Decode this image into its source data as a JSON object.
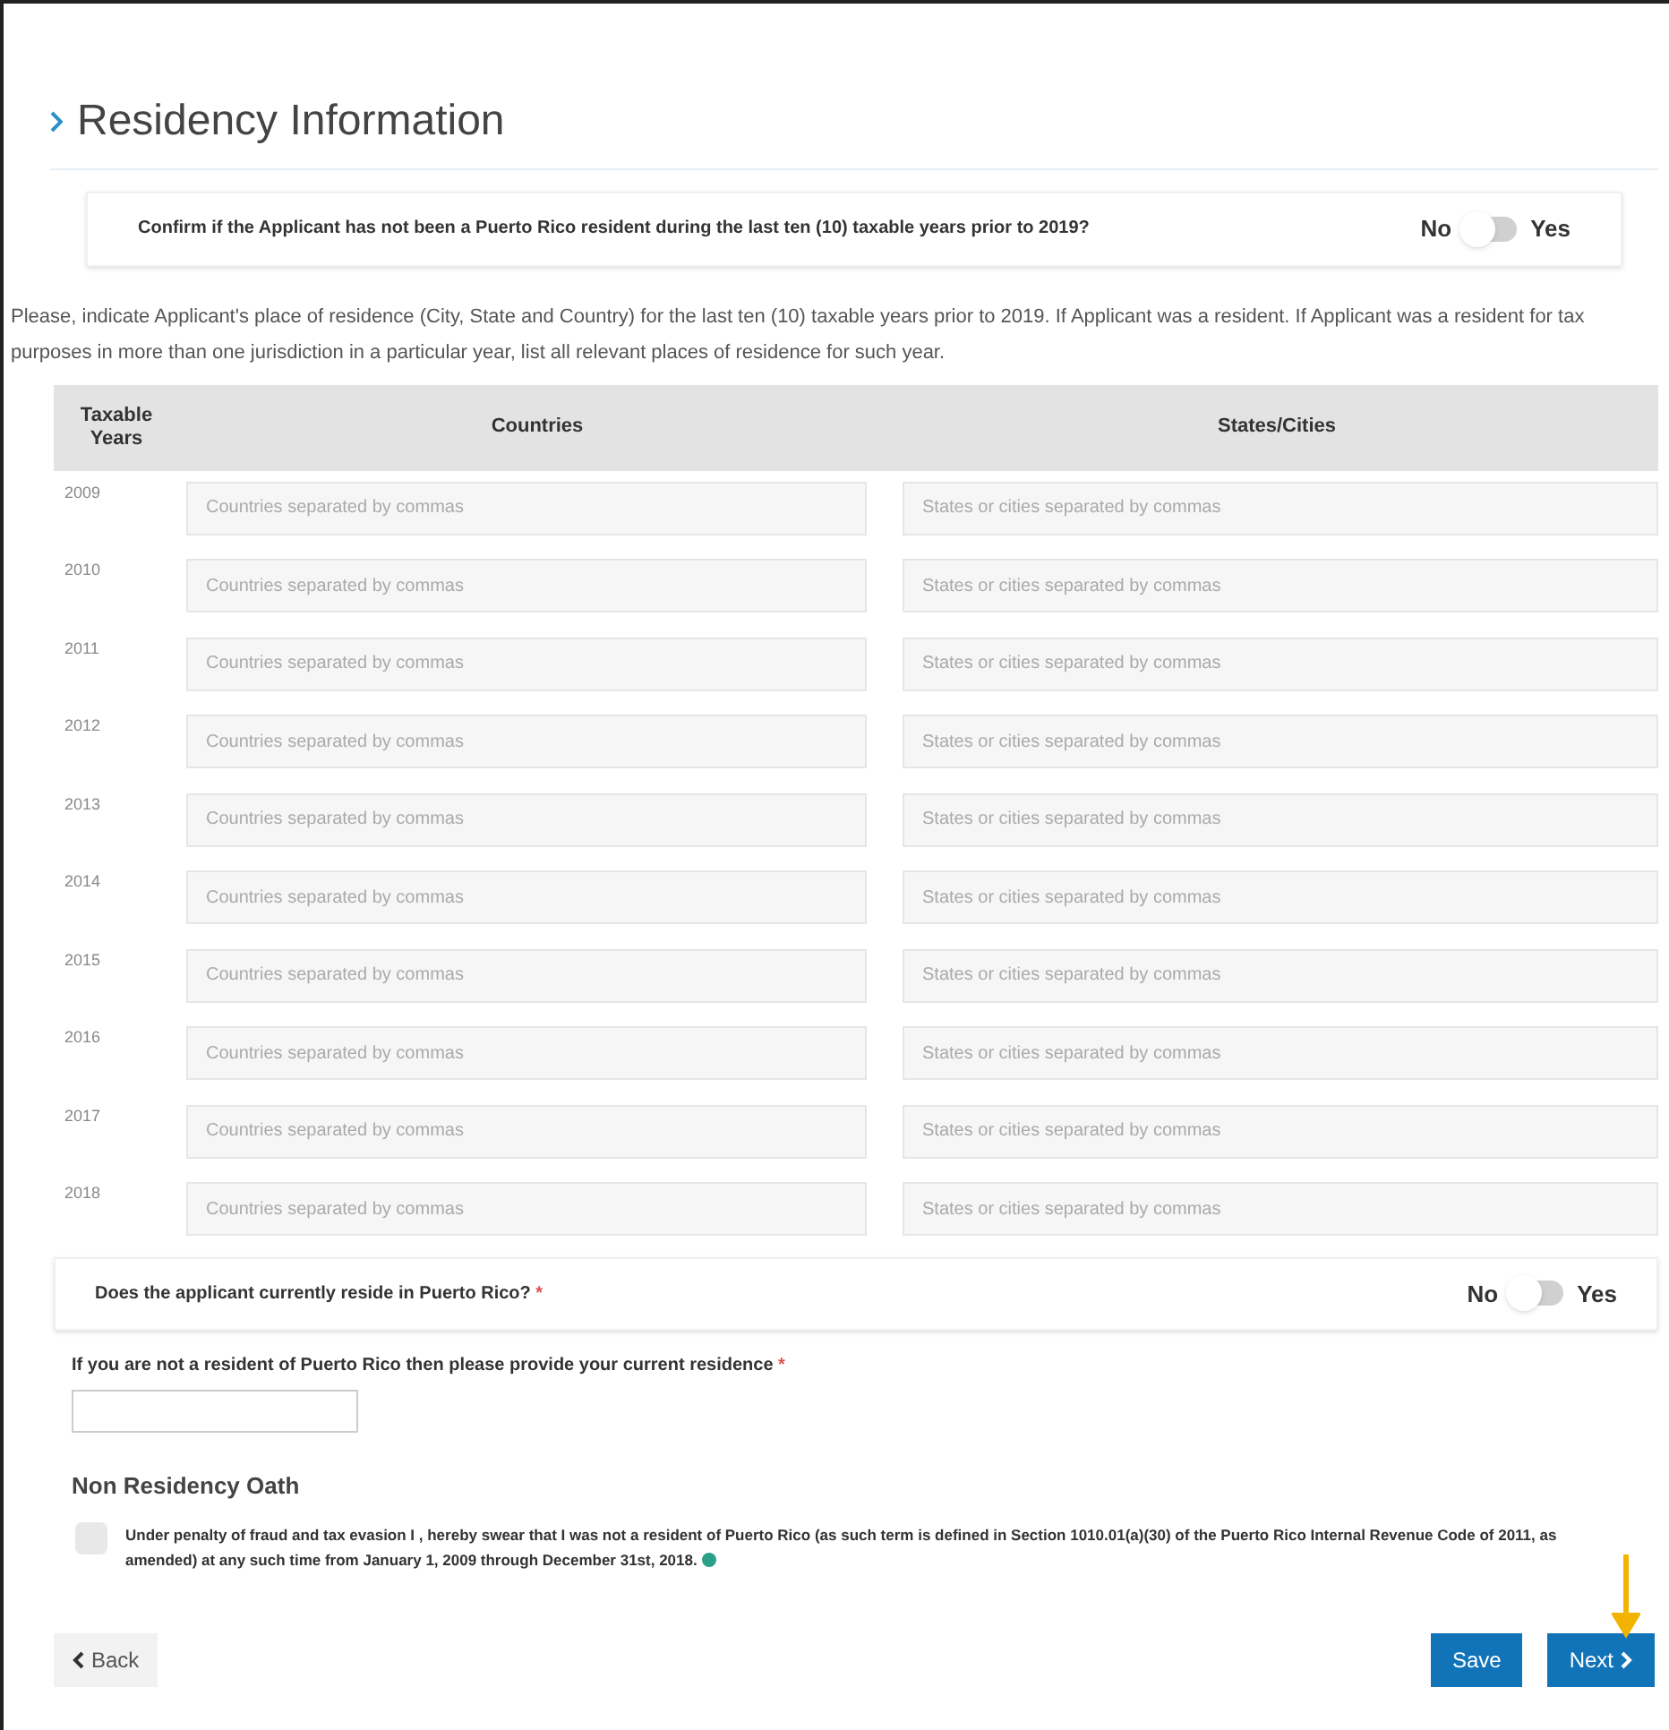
{
  "title": "Residency Information",
  "confirm_question": {
    "label": "Confirm if the Applicant has not been a Puerto Rico resident during the last ten (10) taxable years prior to 2019?",
    "off_label": "No",
    "on_label": "Yes",
    "on": false
  },
  "instructions": "Please, indicate Applicant's place of residence (City, State and Country) for the last ten (10) taxable years prior to 2019. If Applicant was a resident. If Applicant was a resident for tax purposes in more than one jurisdiction in a particular year, list all relevant places of residence for such year.",
  "table": {
    "columns": [
      "Taxable Years",
      "Countries",
      "States/Cities"
    ],
    "rows": [
      {
        "year": "2009",
        "countries_placeholder": "Countries separated by commas",
        "states_placeholder": "States or cities separated by commas"
      },
      {
        "year": "2010",
        "countries_placeholder": "Countries separated by commas",
        "states_placeholder": "States or cities separated by commas"
      },
      {
        "year": "2011",
        "countries_placeholder": "Countries separated by commas",
        "states_placeholder": "States or cities separated by commas"
      },
      {
        "year": "2012",
        "countries_placeholder": "Countries separated by commas",
        "states_placeholder": "States or cities separated by commas"
      },
      {
        "year": "2013",
        "countries_placeholder": "Countries separated by commas",
        "states_placeholder": "States or cities separated by commas"
      },
      {
        "year": "2014",
        "countries_placeholder": "Countries separated by commas",
        "states_placeholder": "States or cities separated by commas"
      },
      {
        "year": "2015",
        "countries_placeholder": "Countries separated by commas",
        "states_placeholder": "States or cities separated by commas"
      },
      {
        "year": "2016",
        "countries_placeholder": "Countries separated by commas",
        "states_placeholder": "States or cities separated by commas"
      },
      {
        "year": "2017",
        "countries_placeholder": "Countries separated by commas",
        "states_placeholder": "States or cities separated by commas"
      },
      {
        "year": "2018",
        "countries_placeholder": "Countries separated by commas",
        "states_placeholder": "States or cities separated by commas"
      }
    ]
  },
  "reside_question": {
    "label": "Does the applicant currently reside in Puerto Rico?",
    "required_mark": "*",
    "off_label": "No",
    "on_label": "Yes",
    "on": false
  },
  "current_residence": {
    "label": "If you are not a resident of Puerto Rico then please provide your current residence",
    "required_mark": "*"
  },
  "oath": {
    "heading": "Non Residency Oath",
    "text": "Under penalty of fraud and tax evasion I , hereby swear that I was not a resident of Puerto Rico (as such term is defined in Section 1010.01(a)(30) of the Puerto Rico Internal Revenue Code of 2011, as amended) at any such time from January 1, 2009 through December 31st, 2018.",
    "checked": false
  },
  "buttons": {
    "back": "Back",
    "save": "Save",
    "next": "Next"
  }
}
